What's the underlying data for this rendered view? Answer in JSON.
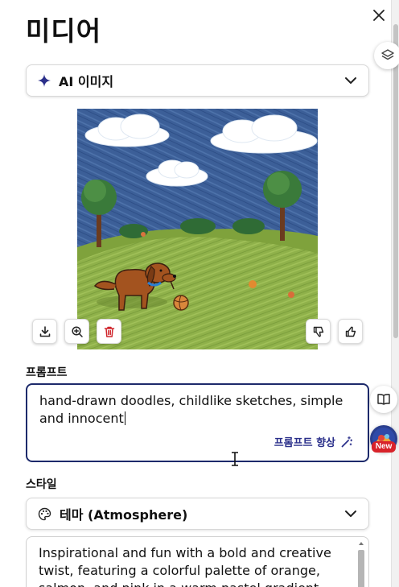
{
  "panel": {
    "title": "미디어",
    "close_icon": "close-icon"
  },
  "media_type": {
    "icon": "sparkle-icon",
    "label": "AI 이미지",
    "accent_color": "#2b2f8a"
  },
  "image": {
    "description_icon": "generated-image",
    "actions": {
      "download": "download-icon",
      "zoom": "zoom-in-icon",
      "delete": "trash-icon",
      "dislike": "thumbs-down-icon",
      "like": "thumbs-up-icon"
    }
  },
  "prompt": {
    "label": "프롬프트",
    "value": "hand-drawn doodles, childlike sketches, simple and innocent",
    "enhance_label": "프롬프트 향상",
    "border_color": "#1d2a6b"
  },
  "style": {
    "label": "스타일",
    "selected": "테마 (Atmosphere)",
    "description": "Inspirational and fun with a bold and creative twist, featuring a colorful palette of orange, salmon, and pink in a warm pastel gradient."
  },
  "side_buttons": {
    "new_badge": "New"
  }
}
